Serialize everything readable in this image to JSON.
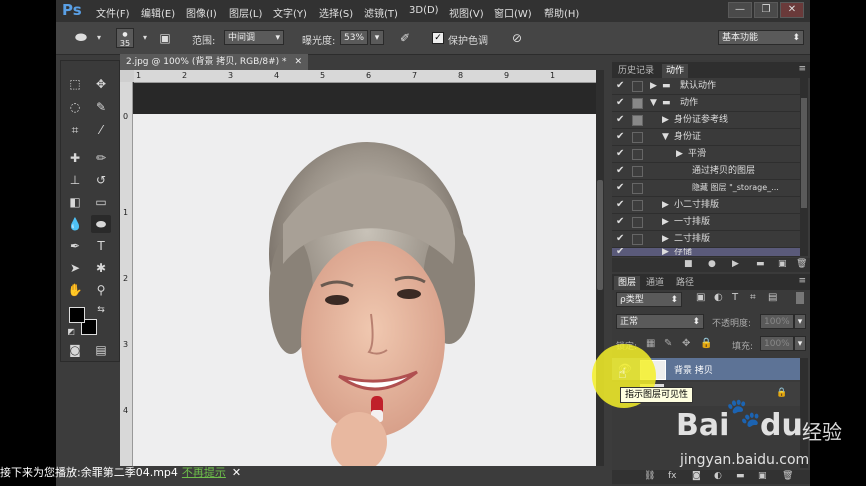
{
  "app": {
    "logo": "Ps"
  },
  "menu": [
    "文件(F)",
    "编辑(E)",
    "图像(I)",
    "图层(L)",
    "文字(Y)",
    "选择(S)",
    "滤镜(T)",
    "3D(D)",
    "视图(V)",
    "窗口(W)",
    "帮助(H)"
  ],
  "window_controls": {
    "minimize": "—",
    "restore": "❐",
    "close": "✕"
  },
  "options": {
    "brush_size": "35",
    "range_label": "范围:",
    "range_value": "中间调",
    "exposure_label": "曝光度:",
    "exposure_value": "53%",
    "protect_tones_label": "保护色调",
    "workspace": "基本功能"
  },
  "document": {
    "tab_title": "2.jpg @ 100% (背景 拷贝, RGB/8#) *",
    "ruler_h": [
      "1",
      "2",
      "3",
      "4",
      "5",
      "6",
      "7",
      "8",
      "9",
      "1"
    ],
    "ruler_v": [
      "0",
      "1",
      "2",
      "3",
      "4"
    ]
  },
  "actions_panel": {
    "tabs": [
      "历史记录",
      "动作"
    ],
    "rows": [
      {
        "label": "默认动作",
        "indent": 0,
        "arrow": "▶"
      },
      {
        "label": "动作",
        "indent": 0,
        "arrow": "▼"
      },
      {
        "label": "身份证参考线",
        "indent": 1,
        "arrow": "▶"
      },
      {
        "label": "身份证",
        "indent": 1,
        "arrow": "▼"
      },
      {
        "label": "平滑",
        "indent": 2,
        "arrow": "▶"
      },
      {
        "label": "通过拷贝的图层",
        "indent": 3,
        "arrow": ""
      },
      {
        "label": "隐藏 图层 \"_storage_...",
        "indent": 3,
        "arrow": ""
      },
      {
        "label": "小二寸排版",
        "indent": 1,
        "arrow": "▶"
      },
      {
        "label": "一寸排版",
        "indent": 1,
        "arrow": "▶"
      },
      {
        "label": "二寸排版",
        "indent": 1,
        "arrow": "▶"
      },
      {
        "label": "存储",
        "indent": 1,
        "arrow": "▶"
      }
    ]
  },
  "layers_panel": {
    "tabs": [
      "图层",
      "通道",
      "路径"
    ],
    "kind_filter": "ρ类型",
    "blend_mode": "正常",
    "opacity_label": "不透明度:",
    "opacity_value": "100%",
    "lock_label": "锁定:",
    "fill_label": "填充:",
    "fill_value": "100%",
    "layer_name": "背景 拷贝",
    "tooltip": "指示图层可见性"
  },
  "overlay": {
    "subtitle_prefix": "接下来为您播放:余罪第二季04.mp4",
    "subtitle_link": "不再提示",
    "subtitle_close": "✕",
    "watermark_brand": "Bai",
    "watermark_brand2": "du",
    "watermark_cn": "经验",
    "watermark_url": "jingyan.baidu.com"
  }
}
